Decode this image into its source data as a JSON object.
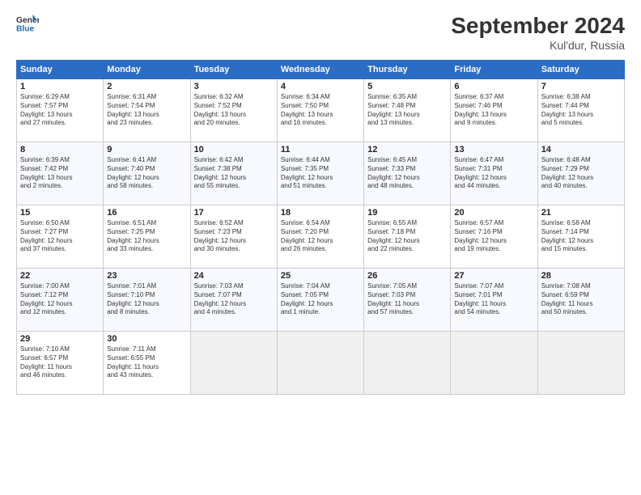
{
  "header": {
    "logo_line1": "General",
    "logo_line2": "Blue",
    "month_title": "September 2024",
    "location": "Kul'dur, Russia"
  },
  "days_of_week": [
    "Sunday",
    "Monday",
    "Tuesday",
    "Wednesday",
    "Thursday",
    "Friday",
    "Saturday"
  ],
  "weeks": [
    [
      {
        "day": "1",
        "lines": [
          "Sunrise: 6:29 AM",
          "Sunset: 7:57 PM",
          "Daylight: 13 hours",
          "and 27 minutes."
        ]
      },
      {
        "day": "2",
        "lines": [
          "Sunrise: 6:31 AM",
          "Sunset: 7:54 PM",
          "Daylight: 13 hours",
          "and 23 minutes."
        ]
      },
      {
        "day": "3",
        "lines": [
          "Sunrise: 6:32 AM",
          "Sunset: 7:52 PM",
          "Daylight: 13 hours",
          "and 20 minutes."
        ]
      },
      {
        "day": "4",
        "lines": [
          "Sunrise: 6:34 AM",
          "Sunset: 7:50 PM",
          "Daylight: 13 hours",
          "and 16 minutes."
        ]
      },
      {
        "day": "5",
        "lines": [
          "Sunrise: 6:35 AM",
          "Sunset: 7:48 PM",
          "Daylight: 13 hours",
          "and 13 minutes."
        ]
      },
      {
        "day": "6",
        "lines": [
          "Sunrise: 6:37 AM",
          "Sunset: 7:46 PM",
          "Daylight: 13 hours",
          "and 9 minutes."
        ]
      },
      {
        "day": "7",
        "lines": [
          "Sunrise: 6:38 AM",
          "Sunset: 7:44 PM",
          "Daylight: 13 hours",
          "and 5 minutes."
        ]
      }
    ],
    [
      {
        "day": "8",
        "lines": [
          "Sunrise: 6:39 AM",
          "Sunset: 7:42 PM",
          "Daylight: 13 hours",
          "and 2 minutes."
        ]
      },
      {
        "day": "9",
        "lines": [
          "Sunrise: 6:41 AM",
          "Sunset: 7:40 PM",
          "Daylight: 12 hours",
          "and 58 minutes."
        ]
      },
      {
        "day": "10",
        "lines": [
          "Sunrise: 6:42 AM",
          "Sunset: 7:38 PM",
          "Daylight: 12 hours",
          "and 55 minutes."
        ]
      },
      {
        "day": "11",
        "lines": [
          "Sunrise: 6:44 AM",
          "Sunset: 7:35 PM",
          "Daylight: 12 hours",
          "and 51 minutes."
        ]
      },
      {
        "day": "12",
        "lines": [
          "Sunrise: 6:45 AM",
          "Sunset: 7:33 PM",
          "Daylight: 12 hours",
          "and 48 minutes."
        ]
      },
      {
        "day": "13",
        "lines": [
          "Sunrise: 6:47 AM",
          "Sunset: 7:31 PM",
          "Daylight: 12 hours",
          "and 44 minutes."
        ]
      },
      {
        "day": "14",
        "lines": [
          "Sunrise: 6:48 AM",
          "Sunset: 7:29 PM",
          "Daylight: 12 hours",
          "and 40 minutes."
        ]
      }
    ],
    [
      {
        "day": "15",
        "lines": [
          "Sunrise: 6:50 AM",
          "Sunset: 7:27 PM",
          "Daylight: 12 hours",
          "and 37 minutes."
        ]
      },
      {
        "day": "16",
        "lines": [
          "Sunrise: 6:51 AM",
          "Sunset: 7:25 PM",
          "Daylight: 12 hours",
          "and 33 minutes."
        ]
      },
      {
        "day": "17",
        "lines": [
          "Sunrise: 6:52 AM",
          "Sunset: 7:23 PM",
          "Daylight: 12 hours",
          "and 30 minutes."
        ]
      },
      {
        "day": "18",
        "lines": [
          "Sunrise: 6:54 AM",
          "Sunset: 7:20 PM",
          "Daylight: 12 hours",
          "and 26 minutes."
        ]
      },
      {
        "day": "19",
        "lines": [
          "Sunrise: 6:55 AM",
          "Sunset: 7:18 PM",
          "Daylight: 12 hours",
          "and 22 minutes."
        ]
      },
      {
        "day": "20",
        "lines": [
          "Sunrise: 6:57 AM",
          "Sunset: 7:16 PM",
          "Daylight: 12 hours",
          "and 19 minutes."
        ]
      },
      {
        "day": "21",
        "lines": [
          "Sunrise: 6:58 AM",
          "Sunset: 7:14 PM",
          "Daylight: 12 hours",
          "and 15 minutes."
        ]
      }
    ],
    [
      {
        "day": "22",
        "lines": [
          "Sunrise: 7:00 AM",
          "Sunset: 7:12 PM",
          "Daylight: 12 hours",
          "and 12 minutes."
        ]
      },
      {
        "day": "23",
        "lines": [
          "Sunrise: 7:01 AM",
          "Sunset: 7:10 PM",
          "Daylight: 12 hours",
          "and 8 minutes."
        ]
      },
      {
        "day": "24",
        "lines": [
          "Sunrise: 7:03 AM",
          "Sunset: 7:07 PM",
          "Daylight: 12 hours",
          "and 4 minutes."
        ]
      },
      {
        "day": "25",
        "lines": [
          "Sunrise: 7:04 AM",
          "Sunset: 7:05 PM",
          "Daylight: 12 hours",
          "and 1 minute."
        ]
      },
      {
        "day": "26",
        "lines": [
          "Sunrise: 7:05 AM",
          "Sunset: 7:03 PM",
          "Daylight: 11 hours",
          "and 57 minutes."
        ]
      },
      {
        "day": "27",
        "lines": [
          "Sunrise: 7:07 AM",
          "Sunset: 7:01 PM",
          "Daylight: 11 hours",
          "and 54 minutes."
        ]
      },
      {
        "day": "28",
        "lines": [
          "Sunrise: 7:08 AM",
          "Sunset: 6:59 PM",
          "Daylight: 11 hours",
          "and 50 minutes."
        ]
      }
    ],
    [
      {
        "day": "29",
        "lines": [
          "Sunrise: 7:10 AM",
          "Sunset: 6:57 PM",
          "Daylight: 11 hours",
          "and 46 minutes."
        ]
      },
      {
        "day": "30",
        "lines": [
          "Sunrise: 7:11 AM",
          "Sunset: 6:55 PM",
          "Daylight: 11 hours",
          "and 43 minutes."
        ]
      },
      {
        "day": "",
        "lines": []
      },
      {
        "day": "",
        "lines": []
      },
      {
        "day": "",
        "lines": []
      },
      {
        "day": "",
        "lines": []
      },
      {
        "day": "",
        "lines": []
      }
    ]
  ]
}
